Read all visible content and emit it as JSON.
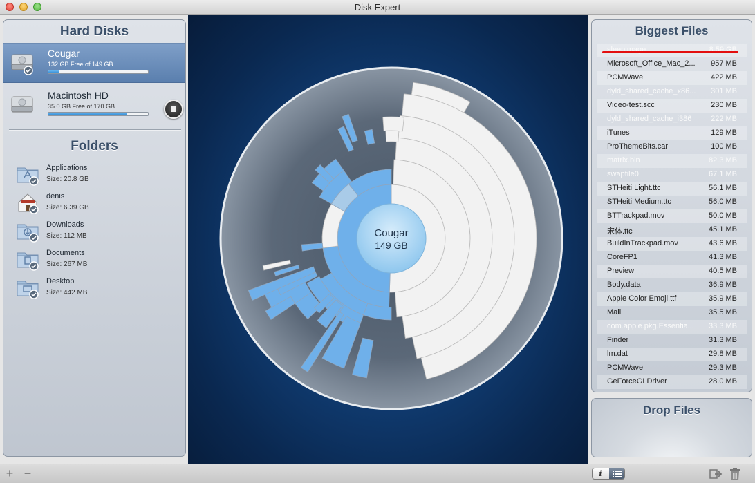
{
  "window": {
    "title": "Disk Expert"
  },
  "hard_disks": {
    "title": "Hard Disks",
    "items": [
      {
        "name": "Cougar",
        "free_text": "132 GB Free of 149 GB",
        "used_fraction": 0.11,
        "selected": true
      },
      {
        "name": "Macintosh HD",
        "free_text": "35.0 GB Free of 170 GB",
        "used_fraction": 0.79,
        "selected": false
      }
    ]
  },
  "folders": {
    "title": "Folders",
    "items": [
      {
        "name": "Applications",
        "size": "Size: 20.8 GB",
        "icon": "applications-folder-icon"
      },
      {
        "name": "denis",
        "size": "Size: 6.39 GB",
        "icon": "home-folder-icon"
      },
      {
        "name": "Downloads",
        "size": "Size: 112 MB",
        "icon": "downloads-folder-icon"
      },
      {
        "name": "Documents",
        "size": "Size: 267 MB",
        "icon": "documents-folder-icon"
      },
      {
        "name": "Desktop",
        "size": "Size: 442 MB",
        "icon": "desktop-folder-icon"
      }
    ]
  },
  "sunburst": {
    "center_name": "Cougar",
    "center_size": "149 GB"
  },
  "biggest_files": {
    "title": "Biggest Files",
    "items": [
      {
        "name": "sleepimage",
        "size": "8.59 GB",
        "system": true
      },
      {
        "name": "Microsoft_Office_Mac_2...",
        "size": "957 MB",
        "system": false
      },
      {
        "name": "PCMWave",
        "size": "422 MB",
        "system": false
      },
      {
        "name": "dyld_shared_cache_x86...",
        "size": "301 MB",
        "system": true
      },
      {
        "name": "Video-test.scc",
        "size": "230 MB",
        "system": false
      },
      {
        "name": "dyld_shared_cache_i386",
        "size": "222 MB",
        "system": true
      },
      {
        "name": "iTunes",
        "size": "129 MB",
        "system": false
      },
      {
        "name": "ProThemeBits.car",
        "size": "100 MB",
        "system": false
      },
      {
        "name": "matrix.bin",
        "size": "82.3 MB",
        "system": true
      },
      {
        "name": "swapfile0",
        "size": "67.1 MB",
        "system": true
      },
      {
        "name": "STHeiti Light.ttc",
        "size": "56.1 MB",
        "system": false
      },
      {
        "name": "STHeiti Medium.ttc",
        "size": "56.0 MB",
        "system": false
      },
      {
        "name": "BTTrackpad.mov",
        "size": "50.0 MB",
        "system": false
      },
      {
        "name": "宋体.ttc",
        "size": "45.1 MB",
        "system": false
      },
      {
        "name": "BuildInTrackpad.mov",
        "size": "43.6 MB",
        "system": false
      },
      {
        "name": "CoreFP1",
        "size": "41.3 MB",
        "system": false
      },
      {
        "name": "Preview",
        "size": "40.5 MB",
        "system": false
      },
      {
        "name": "Body.data",
        "size": "36.9 MB",
        "system": false
      },
      {
        "name": "Apple Color Emoji.ttf",
        "size": "35.9 MB",
        "system": false
      },
      {
        "name": "Mail",
        "size": "35.5 MB",
        "system": false
      },
      {
        "name": "com.apple.pkg.Essentia...",
        "size": "33.3 MB",
        "system": true
      },
      {
        "name": "Finder",
        "size": "31.3 MB",
        "system": false
      },
      {
        "name": "lm.dat",
        "size": "29.8 MB",
        "system": false
      },
      {
        "name": "PCMWave",
        "size": "29.3 MB",
        "system": false
      },
      {
        "name": "GeForceGLDriver",
        "size": "28.0 MB",
        "system": false
      }
    ]
  },
  "drop": {
    "title": "Drop Files"
  },
  "bottom": {
    "add": "+",
    "remove": "−",
    "info_label": "i"
  },
  "colors": {
    "accent_blue": "#6fb0ea",
    "free_space": "#f2f2f2",
    "system_file_text": "#fafafa",
    "highlight_red": "#e30f0f"
  }
}
